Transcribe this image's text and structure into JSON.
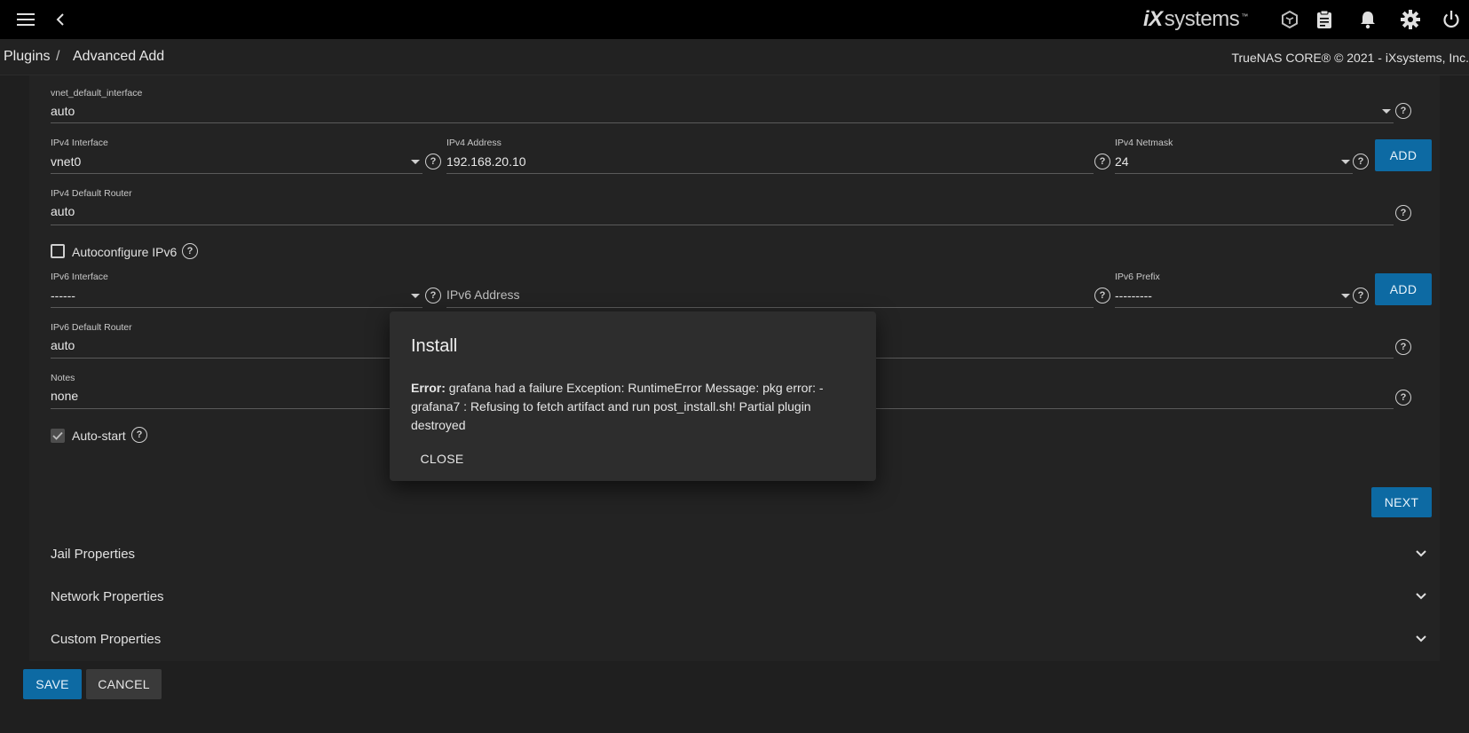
{
  "topbar": {
    "menu_icon": "hamburger-menu-icon",
    "back_icon": "chevron-left-icon",
    "brand_prefix": "iX",
    "brand_suffix": "systems",
    "brand_tm": "™",
    "icons": [
      "truecommand-icon",
      "clipboard-icon",
      "bell-icon",
      "gear-icon",
      "power-icon"
    ]
  },
  "breadcrumb": {
    "root": "Plugins",
    "separator": "/",
    "current": "Advanced Add"
  },
  "copyright": "TrueNAS CORE® © 2021 - iXsystems, Inc.",
  "form": {
    "vnet_default_interface": {
      "label": "vnet_default_interface",
      "value": "auto"
    },
    "ipv4_interface": {
      "label": "IPv4 Interface",
      "value": "vnet0"
    },
    "ipv4_address": {
      "label": "IPv4 Address",
      "value": "192.168.20.10"
    },
    "ipv4_netmask": {
      "label": "IPv4 Netmask",
      "value": "24"
    },
    "ipv4_add_label": "ADD",
    "ipv4_default_router": {
      "label": "IPv4 Default Router",
      "value": "auto"
    },
    "autoconfigure_ipv6": {
      "label": "Autoconfigure IPv6",
      "checked": false
    },
    "ipv6_interface": {
      "label": "IPv6 Interface",
      "value": "------"
    },
    "ipv6_address": {
      "placeholder": "IPv6 Address"
    },
    "ipv6_prefix": {
      "label": "IPv6 Prefix",
      "value": "---------"
    },
    "ipv6_add_label": "ADD",
    "ipv6_default_router": {
      "label": "IPv6 Default Router",
      "value": "auto"
    },
    "notes": {
      "label": "Notes",
      "value": "none"
    },
    "auto_start": {
      "label": "Auto-start",
      "checked": true
    },
    "next_label": "NEXT"
  },
  "accordions": [
    {
      "title": "Jail Properties"
    },
    {
      "title": "Network Properties"
    },
    {
      "title": "Custom Properties"
    }
  ],
  "actions": {
    "save": "SAVE",
    "cancel": "CANCEL"
  },
  "dialog": {
    "title": "Install",
    "error_prefix": "Error:",
    "message": "grafana had a failure Exception: RuntimeError Message: pkg error: - grafana7 : Refusing to fetch artifact and run post_install.sh! Partial plugin destroyed",
    "close_label": "CLOSE"
  },
  "colors": {
    "accent": "#0d6aa3",
    "background": "#1f1f1f",
    "card": "#232323",
    "topbar": "#000000"
  }
}
